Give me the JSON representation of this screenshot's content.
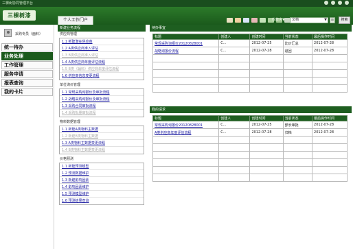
{
  "window": {
    "title": "三棵树协同管理平台"
  },
  "header": {
    "logo_text": "三棵树漆",
    "portal_tab": "个人工作门户",
    "org_select": "收藏夹▼",
    "search_value": "文档",
    "search_button": "◎",
    "submit_button": "搜索",
    "toolbar_icon_colors": [
      "#e9e0c0",
      "#f0d0a0",
      "#d8e4f8",
      "#e6b7b7",
      "#c4e3b9",
      "#a9cf9b",
      "#9cc48d",
      "#c9d7c2"
    ]
  },
  "sidebar": {
    "user_name": "采购专员（面料）",
    "items": [
      {
        "label": "统一待办",
        "active": false
      },
      {
        "label": "业务处理",
        "active": true
      },
      {
        "label": "工作管理",
        "active": false
      },
      {
        "label": "服务申请",
        "active": false
      },
      {
        "label": "报表查询",
        "active": false
      },
      {
        "label": "我的卡片",
        "active": false
      }
    ]
  },
  "middle": {
    "header": "新建业务流程",
    "sections": [
      {
        "title": "供应商管理",
        "items": [
          {
            "label": "1.1 新建潜在供应商",
            "dim": false
          },
          {
            "label": "1.2 A类供应商准入评估",
            "dim": false
          },
          {
            "label": "1.3 B类供应商准入评估",
            "dim": true
          },
          {
            "label": "1.4 A类供应商年度评估流程",
            "dim": false
          },
          {
            "label": "1.5 B类（辅料）供应商年度评估流程",
            "dim": true
          },
          {
            "label": "1.6 供应商信息变更流程",
            "dim": false
          }
        ]
      },
      {
        "title": "单位询价管理",
        "items": [
          {
            "label": "1.1 常规采购询报价及审批流程",
            "dim": false
          },
          {
            "label": "1.2 战略采购询报价及审批流程",
            "dim": false
          },
          {
            "label": "1.3 采购合同审批流程",
            "dim": false
          },
          {
            "label": "1.4 采购批量审批流程",
            "dim": true
          }
        ]
      },
      {
        "title": "物料数据管理",
        "items": [
          {
            "label": "1.1 新建A类物料主数据",
            "dim": false
          },
          {
            "label": "1.2 新建B类物料主数据",
            "dim": true
          },
          {
            "label": "1.3 A类物料主数据变更流程",
            "dim": false
          },
          {
            "label": "1.4 B类物料主数据变更流程",
            "dim": true
          }
        ]
      },
      {
        "title": "价格预测",
        "items": [
          {
            "label": "1.1 新建预测模型",
            "dim": false
          },
          {
            "label": "1.2 预测数据维护",
            "dim": false
          },
          {
            "label": "1.3 新建影响因素",
            "dim": false
          },
          {
            "label": "1.4 影响因素维护",
            "dim": false
          },
          {
            "label": "1.5 预测模型维护",
            "dim": false
          },
          {
            "label": "1.6 预测结果查询",
            "dim": false
          }
        ]
      }
    ]
  },
  "todo": {
    "header": "待办事宜",
    "columns": [
      "标题",
      "创建人",
      "创建时间",
      "当前状态",
      "最后操作时间"
    ],
    "rows": [
      [
        "常规采购询报价20120828001",
        "C...",
        "2012-07-25",
        "比价汇总",
        "2012-07-28"
      ],
      [
        "战略询报价流程",
        "C...",
        "2012-07-28",
        "退回",
        "2012-07-28"
      ]
    ],
    "empty_rows": 5
  },
  "requests": {
    "header": "我的请求",
    "columns": [
      "标题",
      "创建人",
      "创建时间",
      "当前状态",
      "最后操作时间"
    ],
    "rows": [
      [
        "常规采购询报价20120828001",
        "C...",
        "2012-07-25",
        "部长审批",
        "2012-07-28"
      ],
      [
        "A类供应商年度评估流程",
        "C...",
        "2012-07-28",
        "归档",
        "2012-07-28"
      ]
    ],
    "empty_rows": 6
  }
}
